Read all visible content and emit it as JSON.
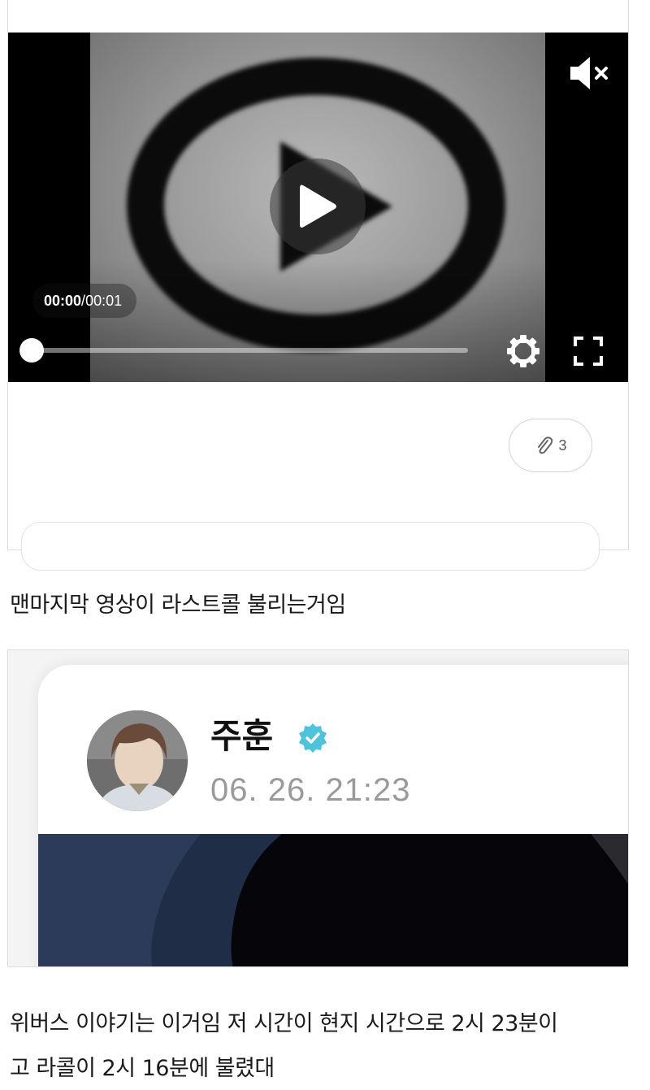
{
  "video": {
    "current_time": "00:00",
    "time_separator": "/ ",
    "duration": "00:01",
    "progress_fraction": 0.0,
    "muted": true
  },
  "attachment": {
    "count": "3"
  },
  "post": {
    "paragraph1": "맨마지막 영상이 라스트콜 불리는거임",
    "paragraph2_line1": "위버스 이야기는 이거임 저 시간이 현지 시간으로 2시 23분이",
    "paragraph2_line2": "고 라콜이 2시 16분에 불렸대"
  },
  "weverse": {
    "username": "주훈",
    "timestamp": "06. 26. 21:23",
    "verified_color": "#4fc3d9"
  },
  "icons": [
    "play-icon",
    "mute-icon",
    "settings-icon",
    "fullscreen-icon",
    "paperclip-icon",
    "verified-icon"
  ]
}
